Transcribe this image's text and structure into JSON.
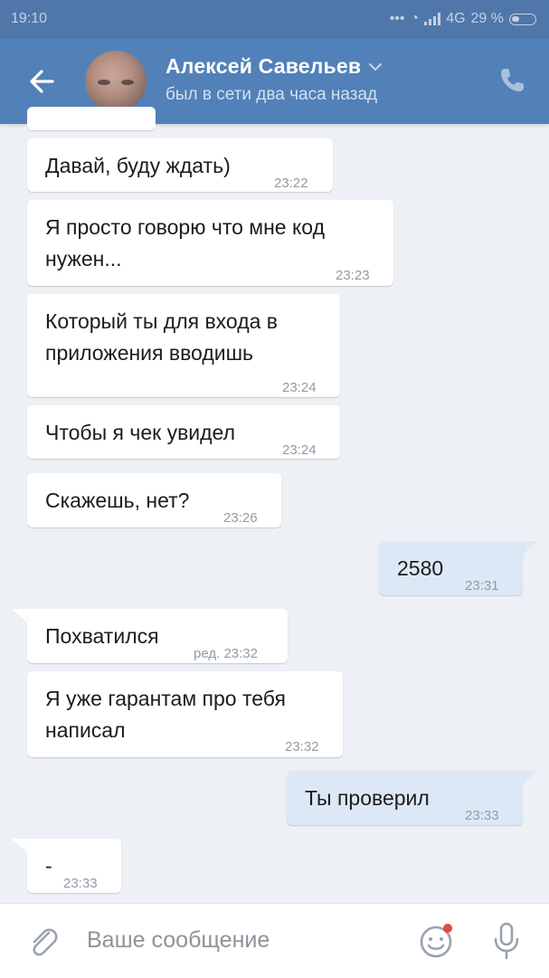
{
  "status_bar": {
    "time": "19:10",
    "network": "4G",
    "battery": "29 %"
  },
  "header": {
    "contact_name": "Алексей Савельев",
    "last_seen": "был в сети два часа назад"
  },
  "messages": [
    {
      "direction": "in",
      "text_lines": [
        "Давай, буду ждать)"
      ],
      "time": "23:22"
    },
    {
      "direction": "in",
      "text_lines": [
        "Я просто говорю что мне код",
        "нужен..."
      ],
      "time": "23:23"
    },
    {
      "direction": "in",
      "text_lines": [
        "Который ты для входа в",
        "приложения вводишь"
      ],
      "time": "23:24"
    },
    {
      "direction": "in",
      "text_lines": [
        "Чтобы я чек увидел"
      ],
      "time": "23:24"
    },
    {
      "direction": "in",
      "text_lines": [
        "Скажешь, нет?"
      ],
      "time": "23:26"
    },
    {
      "direction": "out",
      "text_lines": [
        "2580"
      ],
      "time": "23:31"
    },
    {
      "direction": "in",
      "text_lines": [
        "Похватился"
      ],
      "time": "ред. 23:32"
    },
    {
      "direction": "in",
      "text_lines": [
        "Я уже гарантам про тебя",
        "написал"
      ],
      "time": "23:32"
    },
    {
      "direction": "out",
      "text_lines": [
        "Ты проверил"
      ],
      "time": "23:33"
    },
    {
      "direction": "in",
      "text_lines": [
        "-"
      ],
      "time": "23:33"
    }
  ],
  "composer": {
    "placeholder": "Ваше сообщение"
  },
  "colors": {
    "header": "#5181b8",
    "status_bar": "#4f77aa",
    "background": "#edf0f4",
    "outgoing_bubble": "#dde8f6",
    "incoming_bubble": "#ffffff"
  },
  "icons": [
    "back-arrow-icon",
    "chevron-down-icon",
    "phone-icon",
    "attach-icon",
    "emoji-icon",
    "microphone-icon"
  ]
}
